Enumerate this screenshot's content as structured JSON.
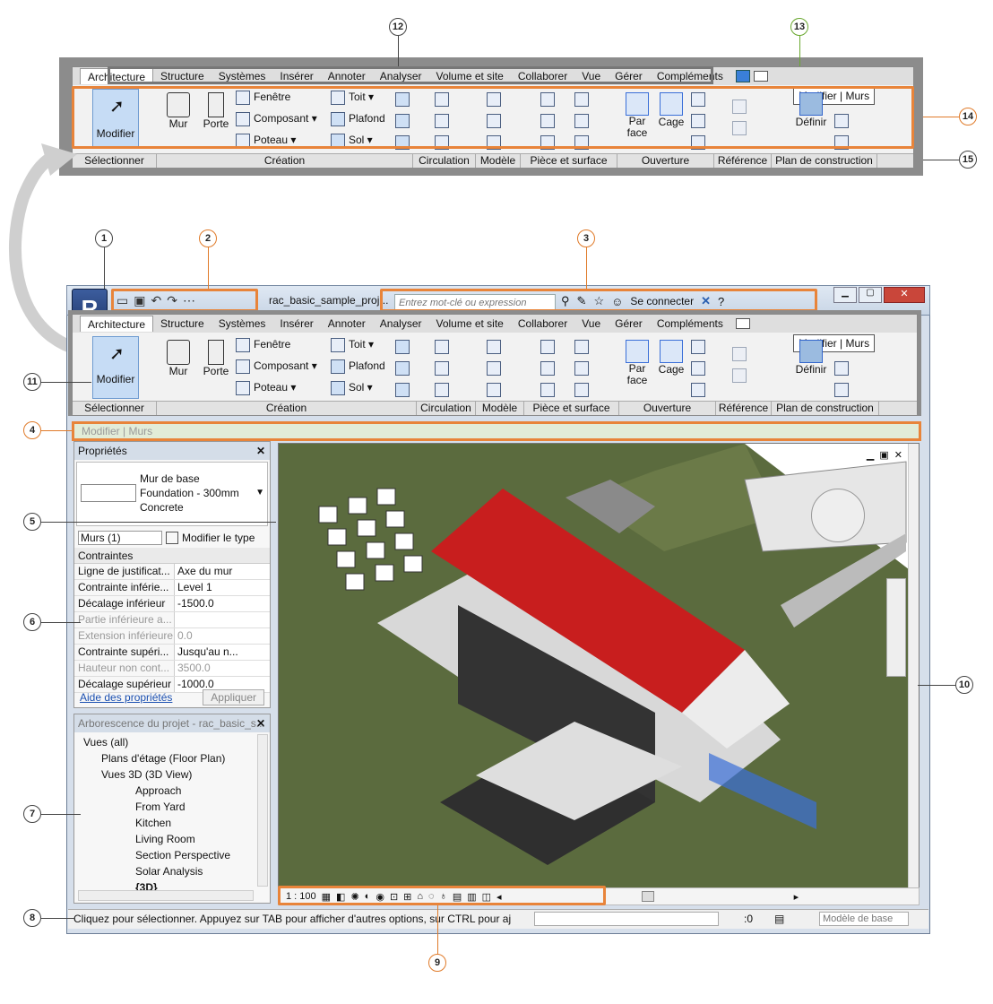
{
  "top_ribbon": {
    "tabs": [
      "Architecture",
      "Structure",
      "Systèmes",
      "Insérer",
      "Annoter",
      "Analyser",
      "Volume et site",
      "Collaborer",
      "Vue",
      "Gérer",
      "Compléments"
    ],
    "active_tab": "Architecture",
    "tooltip": "Modifier | Murs",
    "buttons": {
      "modify": "Modifier",
      "wall": "Mur",
      "door": "Porte",
      "window": "Fenêtre",
      "component": "Composant",
      "column": "Poteau",
      "roof": "Toit",
      "ceiling": "Plafond",
      "floor": "Sol",
      "by_face": "Par face",
      "shaft": "Cage",
      "set": "Définir"
    },
    "panels": [
      "Sélectionner",
      "Création",
      "Circulation",
      "Modèle",
      "Pièce et surface",
      "Ouverture",
      "Référence",
      "Plan de construction"
    ]
  },
  "app": {
    "title": "rac_basic_sample_proj...",
    "search_placeholder": "Entrez mot-clé ou expression",
    "sign_in": "Se connecter",
    "options_bar": "Modifier | Murs"
  },
  "properties": {
    "title": "Propriétés",
    "type_line1": "Mur de base",
    "type_line2": "Foundation - 300mm",
    "type_line3": "Concrete",
    "filter": "Murs (1)",
    "edit_type": "Modifier le type",
    "section": "Contraintes",
    "rows": [
      {
        "k": "Ligne de justificat...",
        "v": "Axe du mur",
        "grey": false
      },
      {
        "k": "Contrainte inférie...",
        "v": "Level 1",
        "grey": false
      },
      {
        "k": "Décalage inférieur",
        "v": "-1500.0",
        "grey": false
      },
      {
        "k": "Partie inférieure a...",
        "v": "",
        "grey": true
      },
      {
        "k": "Extension inférieure",
        "v": "0.0",
        "grey": true
      },
      {
        "k": "Contrainte supéri...",
        "v": "Jusqu'au n...",
        "grey": false
      },
      {
        "k": "Hauteur non cont...",
        "v": "3500.0",
        "grey": true
      },
      {
        "k": "Décalage supérieur",
        "v": "-1000.0",
        "grey": false
      }
    ],
    "help": "Aide des propriétés",
    "apply": "Appliquer"
  },
  "browser": {
    "title": "Arborescence du projet - rac_basic_s...",
    "items": [
      {
        "label": "Vues (all)",
        "indent": 0
      },
      {
        "label": "Plans d'étage (Floor Plan)",
        "indent": 1
      },
      {
        "label": "Vues 3D (3D View)",
        "indent": 1
      },
      {
        "label": "Approach",
        "indent": 2
      },
      {
        "label": "From Yard",
        "indent": 2
      },
      {
        "label": "Kitchen",
        "indent": 2
      },
      {
        "label": "Living Room",
        "indent": 2
      },
      {
        "label": "Section Perspective",
        "indent": 2
      },
      {
        "label": "Solar Analysis",
        "indent": 2
      },
      {
        "label": "{3D}",
        "indent": 2
      }
    ]
  },
  "view_control": {
    "scale": "1 : 100"
  },
  "status": {
    "message": "Cliquez pour sélectionner. Appuyez sur TAB pour afficher d'autres options, sur CTRL pour aj",
    "count": ":0",
    "model": "Modèle de base"
  },
  "callouts": [
    "1",
    "2",
    "3",
    "4",
    "5",
    "6",
    "7",
    "8",
    "9",
    "10",
    "11",
    "12",
    "13",
    "14",
    "15"
  ],
  "colors": {
    "orange": "#e8843a",
    "roof": "#c81e1e",
    "grass": "#5a6a3c",
    "selection": "#3a6fd8"
  }
}
